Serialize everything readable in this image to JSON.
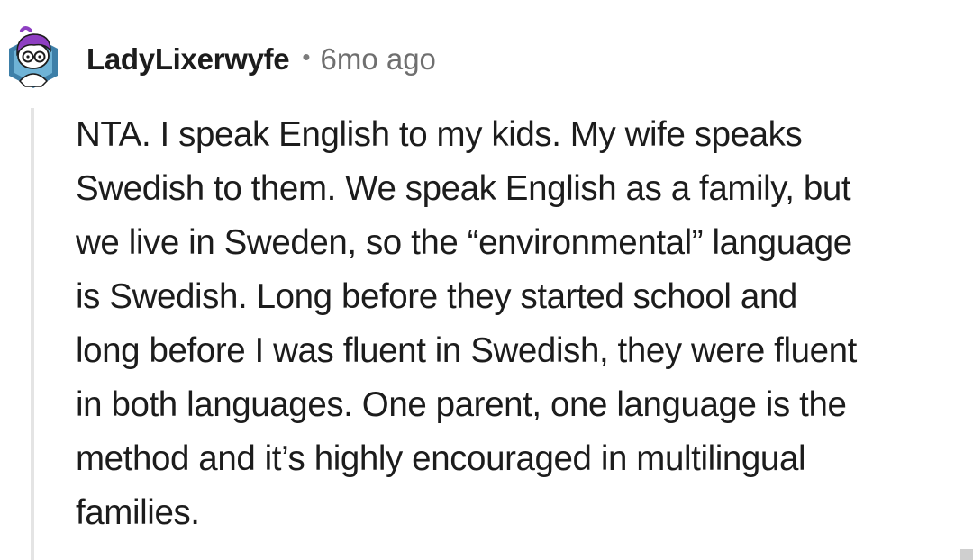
{
  "comment": {
    "author": "LadyLixerwyfe",
    "separator": "•",
    "timestamp": "6mo ago",
    "avatar_icon": "snoo-avatar-purple-hair-glasses",
    "body_lines": [
      "NTA. I speak English to my kids. My wife speaks",
      "Swedish to them. We speak English as a family, but",
      "we live in Sweden, so the “environmental” language",
      "is Swedish. Long before they started school and",
      "long before I was fluent in Swedish, they were fluent",
      "in both languages. One parent, one language is the",
      "method and it’s highly encouraged in multilingual",
      "families."
    ]
  },
  "colors": {
    "text": "#1c1c1c",
    "meta": "#6f6f6f",
    "thread_line": "#e4e4e4",
    "avatar_hair": "#8e3fc2",
    "avatar_bg": "#3d7fa8"
  }
}
